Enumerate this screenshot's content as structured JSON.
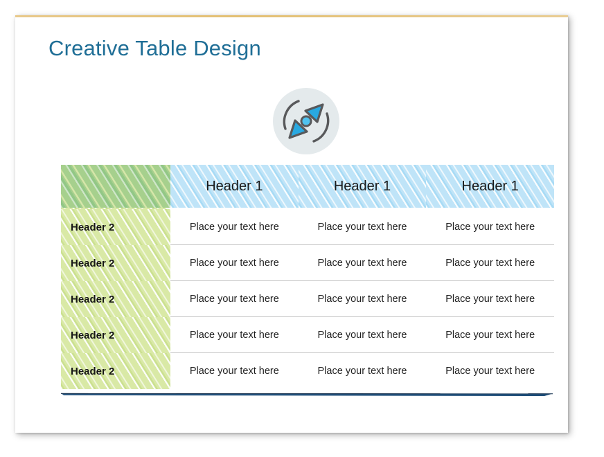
{
  "slide": {
    "title": "Creative Table Design",
    "accent_color": "#1F6E96",
    "top_border_color": "#e3bf72",
    "background": "#ffffff"
  },
  "icon": {
    "name": "compass-navigation-icon",
    "circle_color": "#E4EAEC",
    "arrow_color": "#29A9E1",
    "outline_color": "#58595B"
  },
  "table": {
    "header_hatch_color": "#bfe4f8",
    "corner_hatch_color": "#a6d08d",
    "row_head_hatch_color": "#d9e9a6",
    "rule_color": "#1F4E79",
    "separator_color": "#c6c6c6",
    "corner_header_label": "",
    "column_headers": [
      "Header 1",
      "Header 1",
      "Header 1"
    ],
    "rows": [
      {
        "head": "Header 2",
        "cells": [
          "Place your text here",
          "Place your text here",
          "Place your text here"
        ]
      },
      {
        "head": "Header 2",
        "cells": [
          "Place your text here",
          "Place your text here",
          "Place your text here"
        ]
      },
      {
        "head": "Header 2",
        "cells": [
          "Place your text here",
          "Place your text here",
          "Place your text here"
        ]
      },
      {
        "head": "Header 2",
        "cells": [
          "Place your text here",
          "Place your text here",
          "Place your text here"
        ]
      },
      {
        "head": "Header 2",
        "cells": [
          "Place your text here",
          "Place your text here",
          "Place your text here"
        ]
      }
    ]
  }
}
